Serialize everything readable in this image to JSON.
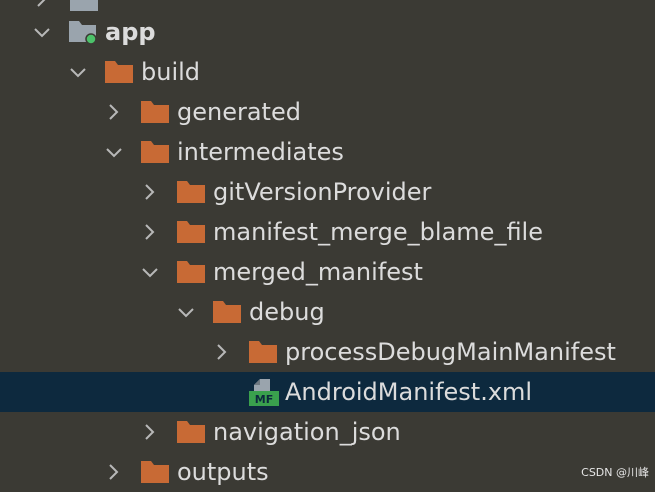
{
  "tree": {
    "rows": [
      {
        "label": "",
        "icon": "folder-icon",
        "expanded": false,
        "selected": false
      },
      {
        "label": "app",
        "icon": "module-folder-icon",
        "expanded": true,
        "selected": false
      },
      {
        "label": "build",
        "icon": "folder-icon",
        "expanded": true,
        "selected": false
      },
      {
        "label": "generated",
        "icon": "folder-icon",
        "expanded": false,
        "selected": false
      },
      {
        "label": "intermediates",
        "icon": "folder-icon",
        "expanded": true,
        "selected": false
      },
      {
        "label": "gitVersionProvider",
        "icon": "folder-icon",
        "expanded": false,
        "selected": false
      },
      {
        "label": "manifest_merge_blame_file",
        "icon": "folder-icon",
        "expanded": false,
        "selected": false
      },
      {
        "label": "merged_manifest",
        "icon": "folder-icon",
        "expanded": true,
        "selected": false
      },
      {
        "label": "debug",
        "icon": "folder-icon",
        "expanded": true,
        "selected": false
      },
      {
        "label": "processDebugMainManifest",
        "icon": "folder-icon",
        "expanded": false,
        "selected": false
      },
      {
        "label": "AndroidManifest.xml",
        "icon": "manifest-file-icon",
        "expanded": null,
        "selected": true
      },
      {
        "label": "navigation_json",
        "icon": "folder-icon",
        "expanded": false,
        "selected": false
      },
      {
        "label": "outputs",
        "icon": "folder-icon",
        "expanded": false,
        "selected": false
      }
    ],
    "manifest_icon_text": "MF"
  },
  "watermark": "CSDN @川峰",
  "colors": {
    "background": "#3b3a34",
    "selection": "#0d293e",
    "folder": "#c86a35",
    "module_folder": "#9aa4ad",
    "module_dot": "#4cc26a",
    "manifest_green": "#3aa04d",
    "text": "#dcdcdc",
    "chevron": "#b8b8b8"
  }
}
